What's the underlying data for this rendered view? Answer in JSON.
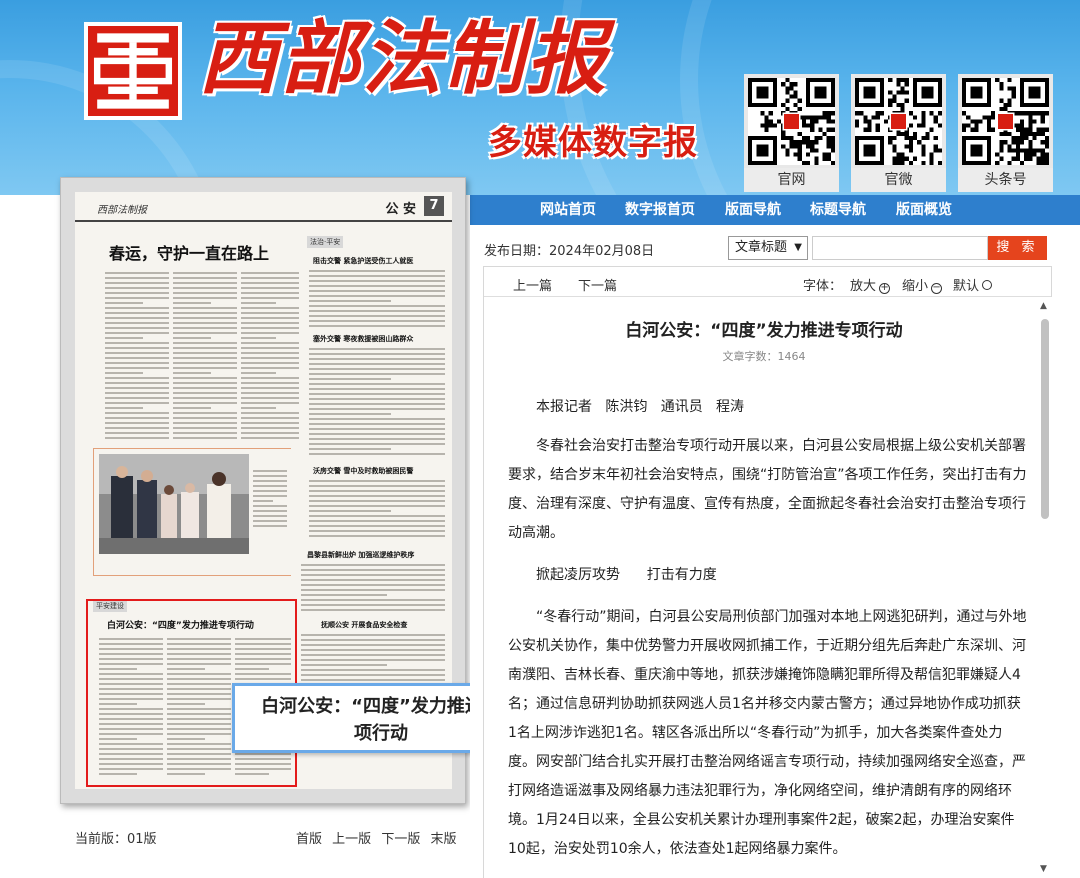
{
  "header": {
    "masthead": "西部法制报",
    "subtitle": "多媒体数字报",
    "qr_codes": [
      {
        "label": "官网"
      },
      {
        "label": "官微"
      },
      {
        "label": "头条号"
      }
    ]
  },
  "nav": {
    "items": [
      "网站首页",
      "数字报首页",
      "版面导航",
      "标题导航",
      "版面概览"
    ]
  },
  "newspaper": {
    "brand": "西部法制报",
    "section": "公 安",
    "page_no": "7",
    "headline": "春运，守护一直在路上",
    "photo_caption": "",
    "right_col_titles": [
      "阻击交警  紧急护送受伤工人就医",
      "塞外交警  寒夜救援被困山路群众",
      "沃房交警  雪中及时救助被困民警",
      "昌黎县新鲜出炉  加强巡逻维护秩序",
      "抚顺公安  开展食品安全检查"
    ],
    "highlight_title": "白河公安：“四度”发力推进专项行动",
    "tooltip": "白河公安：“四度”发力推进专项行动"
  },
  "footer_left": {
    "current_page": "当前版：01版",
    "links": [
      "首版",
      "上一版",
      "下一版",
      "末版"
    ]
  },
  "search": {
    "date_label": "发布日期：2024年02月08日",
    "type_selected": "文章标题",
    "placeholder": "",
    "button": "搜 索"
  },
  "toolbar": {
    "prev": "上一篇",
    "next": "下一篇",
    "font_label": "字体：",
    "zoom_in": "放大",
    "zoom_out": "缩小",
    "default": "默认"
  },
  "article": {
    "title": "白河公安：“四度”发力推进专项行动",
    "word_count": "文章字数：1464",
    "byline": "本报记者   陈洪钧   通讯员   程涛",
    "paragraphs": [
      "冬春社会治安打击整治专项行动开展以来，白河县公安局根据上级公安机关部署要求，结合岁末年初社会治安特点，围绕“打防管治宣”各项工作任务，突出打击有力度、治理有深度、守护有温度、宣传有热度，全面掀起冬春社会治安打击整治专项行动高潮。",
      "掀起凌厉攻势      打击有力度",
      "“冬春行动”期间，白河县公安局刑侦部门加强对本地上网逃犯研判，通过与外地公安机关协作，集中优势警力开展收网抓捕工作，于近期分组先后奔赴广东深圳、河南濮阳、吉林长春、重庆渝中等地，抓获涉嫌掩饰隐瞒犯罪所得及帮信犯罪嫌疑人4名；通过信息研判协助抓获网逃人员1名并移交内蒙古警方；通过异地协作成功抓获1名上网涉诈逃犯1名。辖区各派出所以“冬春行动”为抓手，加大各类案件查处力度。网安部门结合扎实开展打击整治网络谣言专项行动，持续加强网络安全巡查，严打网络造谣滋事及网络暴力违法犯罪行为，净化网络空间，维护清朗有序的网络环境。1月24日以来，全县公安机关累计办理刑事案件2起，破案2起，办理治安案件10起，治安处罚10余人，依法查处1起网络暴力案件。"
    ]
  },
  "colors": {
    "header_blue": "#3a9ee0",
    "nav_blue": "#2e7fcd",
    "brand_red": "#d81e12",
    "search_orange": "#e5441d",
    "highlight_red": "#e31b1b"
  }
}
